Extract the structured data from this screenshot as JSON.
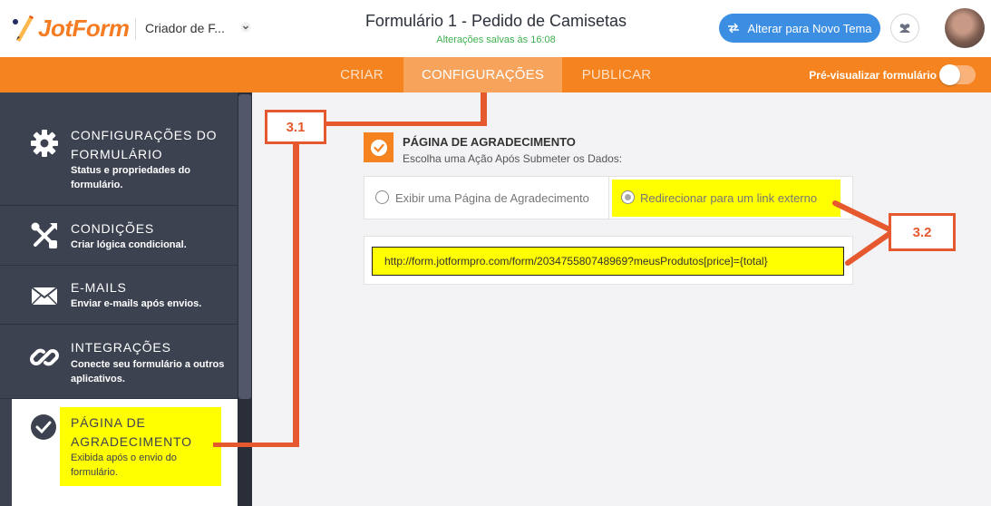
{
  "header": {
    "logo_text": "JotForm",
    "app_selector": "Criador de F...",
    "form_title": "Formulário 1 - Pedido de Camisetas",
    "saved_status": "Alterações salvas às 16:08",
    "theme_button": "Alterar para Novo Tema"
  },
  "nav": {
    "tabs": [
      "CRIAR",
      "CONFIGURAÇÕES",
      "PUBLICAR"
    ],
    "active_tab": "CONFIGURAÇÕES",
    "preview_label": "Pré-visualizar formulário",
    "preview_enabled": false
  },
  "sidebar": {
    "items": [
      {
        "title": "CONFIGURAÇÕES DO FORMULÁRIO",
        "title_l1": "CONFIGURAÇÕES DO",
        "title_l2": "FORMULÁRIO",
        "desc_l1": "Status e propriedades do",
        "desc_l2": "formulário.",
        "icon": "gear-icon"
      },
      {
        "title": "CONDIÇÕES",
        "desc_l1": "Criar lógica condicional.",
        "icon": "tools-icon"
      },
      {
        "title": "E-MAILS",
        "desc_l1": "Enviar e-mails após envios.",
        "icon": "envelope-icon"
      },
      {
        "title": "INTEGRAÇÕES",
        "desc_l1": "Conecte seu formulário a outros",
        "desc_l2": "aplicativos.",
        "icon": "link-icon"
      },
      {
        "title": "PÁGINA DE AGRADECIMENTO",
        "title_l1": "PÁGINA DE",
        "title_l2": "AGRADECIMENTO",
        "desc_l1": "Exibida após o envio do",
        "desc_l2": "formulário.",
        "icon": "check-circle-icon",
        "active": true
      }
    ]
  },
  "thankyou": {
    "title": "PÁGINA DE AGRADECIMENTO",
    "subtitle": "Escolha uma Ação Após Submeter os Dados:",
    "option_show": "Exibir uma Página de Agradecimento",
    "option_redirect": "Redirecionar para um link externo",
    "selected": "option_redirect",
    "redirect_url": "http://form.jotformpro.com/form/203475580748969?meusProdutos[price]={total}"
  },
  "annotations": {
    "label_1": "3.1",
    "label_2": "3.2"
  },
  "colors": {
    "brand_orange": "#f58420",
    "annotation": "#e6582e",
    "highlight": "#ffff00",
    "sidebar_bg": "#3d4250",
    "button_blue": "#3c8ee3"
  }
}
